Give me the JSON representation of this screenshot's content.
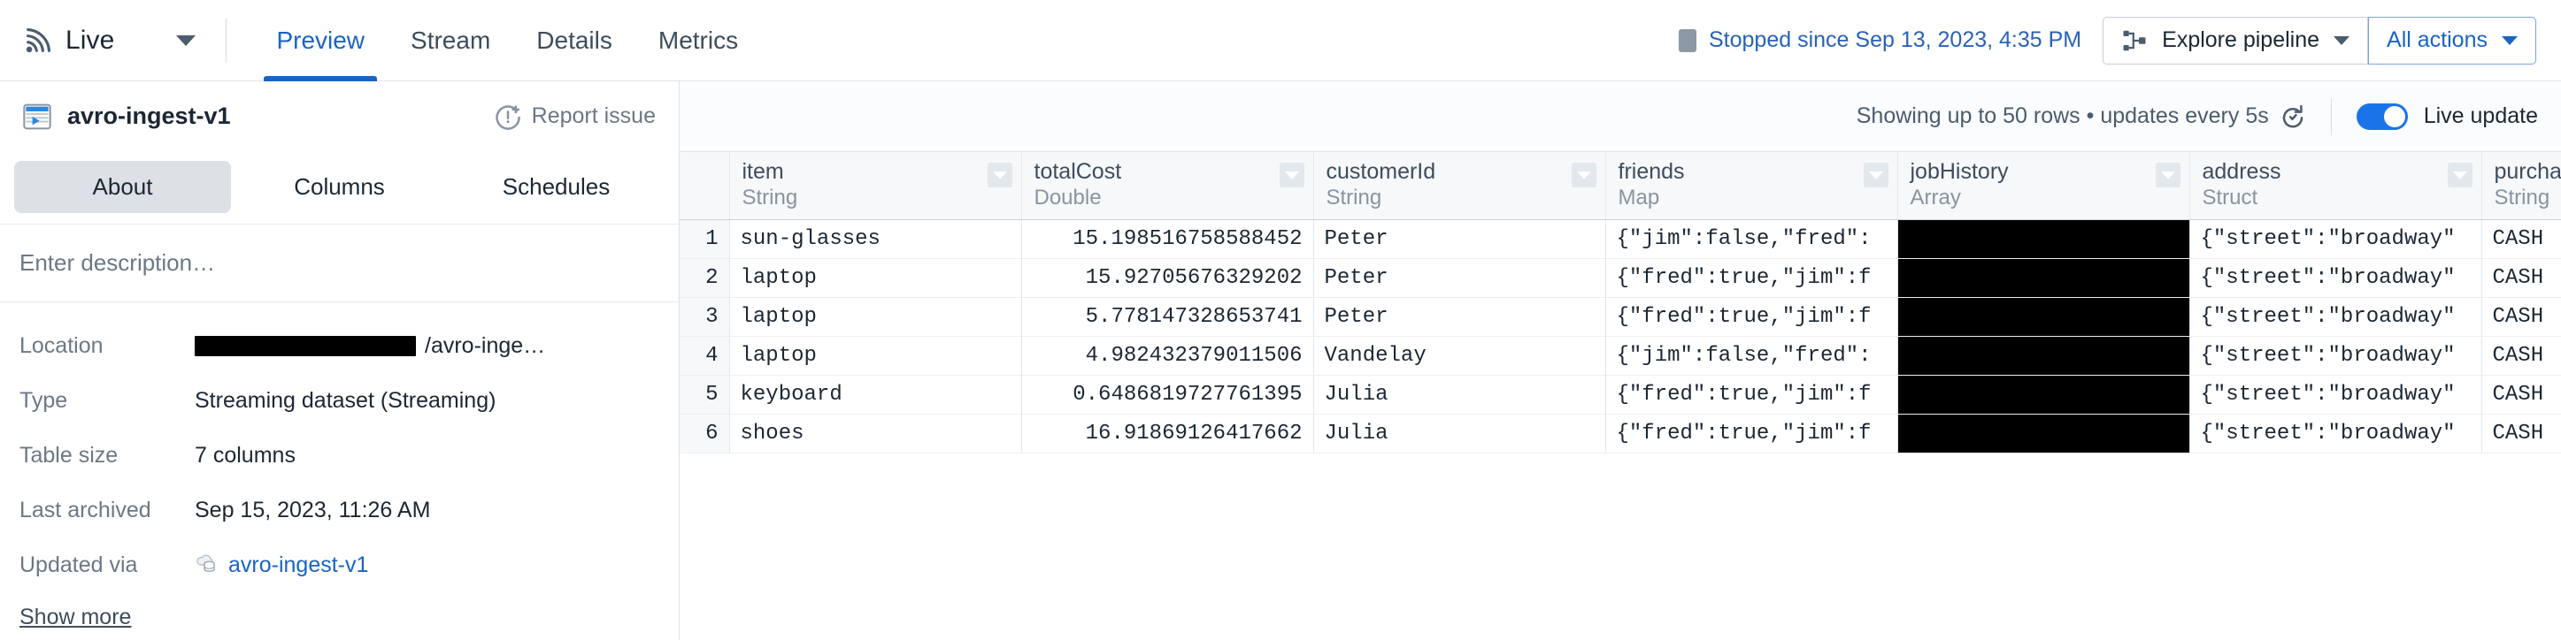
{
  "topbar": {
    "live_label": "Live",
    "tabs": [
      {
        "label": "Preview",
        "active": true
      },
      {
        "label": "Stream",
        "active": false
      },
      {
        "label": "Details",
        "active": false
      },
      {
        "label": "Metrics",
        "active": false
      }
    ],
    "status_text": "Stopped since Sep 13, 2023, 4:35 PM",
    "explore_pipeline_label": "Explore pipeline",
    "all_actions_label": "All actions",
    "accent_color": "#1a63c4",
    "link_color": "#2962b8"
  },
  "subbar": {
    "dataset_name": "avro-ingest-v1",
    "report_issue_label": "Report issue",
    "showing_text": "Showing up to 50 rows • updates every 5s",
    "live_update_label": "Live update",
    "toggle_on": true,
    "toggle_color": "#1a73e8"
  },
  "sidebar": {
    "tabs": [
      {
        "label": "About",
        "active": true
      },
      {
        "label": "Columns",
        "active": false
      },
      {
        "label": "Schedules",
        "active": false
      }
    ],
    "description_placeholder": "Enter description…",
    "meta": [
      {
        "key": "Location",
        "value": "/avro-inge…",
        "redacted": true
      },
      {
        "key": "Type",
        "value": "Streaming dataset (Streaming)",
        "redacted": false
      },
      {
        "key": "Table size",
        "value": "7 columns",
        "redacted": false
      },
      {
        "key": "Last archived",
        "value": "Sep 15, 2023, 11:26 AM",
        "redacted": false
      },
      {
        "key": "Updated via",
        "value": "avro-ingest-v1",
        "redacted": false,
        "link": true,
        "icon": "cloud-database-icon"
      }
    ],
    "show_more_label": "Show more"
  },
  "table": {
    "columns": [
      {
        "name": "item",
        "type": "String"
      },
      {
        "name": "totalCost",
        "type": "Double"
      },
      {
        "name": "customerId",
        "type": "String"
      },
      {
        "name": "friends",
        "type": "Map"
      },
      {
        "name": "jobHistory",
        "type": "Array"
      },
      {
        "name": "address",
        "type": "Struct"
      },
      {
        "name": "purchaseType",
        "type": "String"
      }
    ],
    "rows": [
      {
        "n": "1",
        "item": "sun-glasses",
        "totalCost": "15.198516758588452",
        "customerId": "Peter",
        "friends": "{\"jim\":false,\"fred\":",
        "jobHistory": "",
        "address": "{\"street\":\"broadway\"",
        "purchaseType": "CASH"
      },
      {
        "n": "2",
        "item": "laptop",
        "totalCost": "15.92705676329202",
        "customerId": "Peter",
        "friends": "{\"fred\":true,\"jim\":f",
        "jobHistory": "",
        "address": "{\"street\":\"broadway\"",
        "purchaseType": "CASH"
      },
      {
        "n": "3",
        "item": "laptop",
        "totalCost": "5.778147328653741",
        "customerId": "Peter",
        "friends": "{\"fred\":true,\"jim\":f",
        "jobHistory": "",
        "address": "{\"street\":\"broadway\"",
        "purchaseType": "CASH"
      },
      {
        "n": "4",
        "item": "laptop",
        "totalCost": "4.982432379011506",
        "customerId": "Vandelay",
        "friends": "{\"jim\":false,\"fred\":",
        "jobHistory": "",
        "address": "{\"street\":\"broadway\"",
        "purchaseType": "CASH"
      },
      {
        "n": "5",
        "item": "keyboard",
        "totalCost": "0.6486819727761395",
        "customerId": "Julia",
        "friends": "{\"fred\":true,\"jim\":f",
        "jobHistory": "",
        "address": "{\"street\":\"broadway\"",
        "purchaseType": "CASH"
      },
      {
        "n": "6",
        "item": "shoes",
        "totalCost": "16.91869126417662",
        "customerId": "Julia",
        "friends": "{\"fred\":true,\"jim\":f",
        "jobHistory": "",
        "address": "{\"street\":\"broadway\"",
        "purchaseType": "CASH"
      }
    ]
  }
}
